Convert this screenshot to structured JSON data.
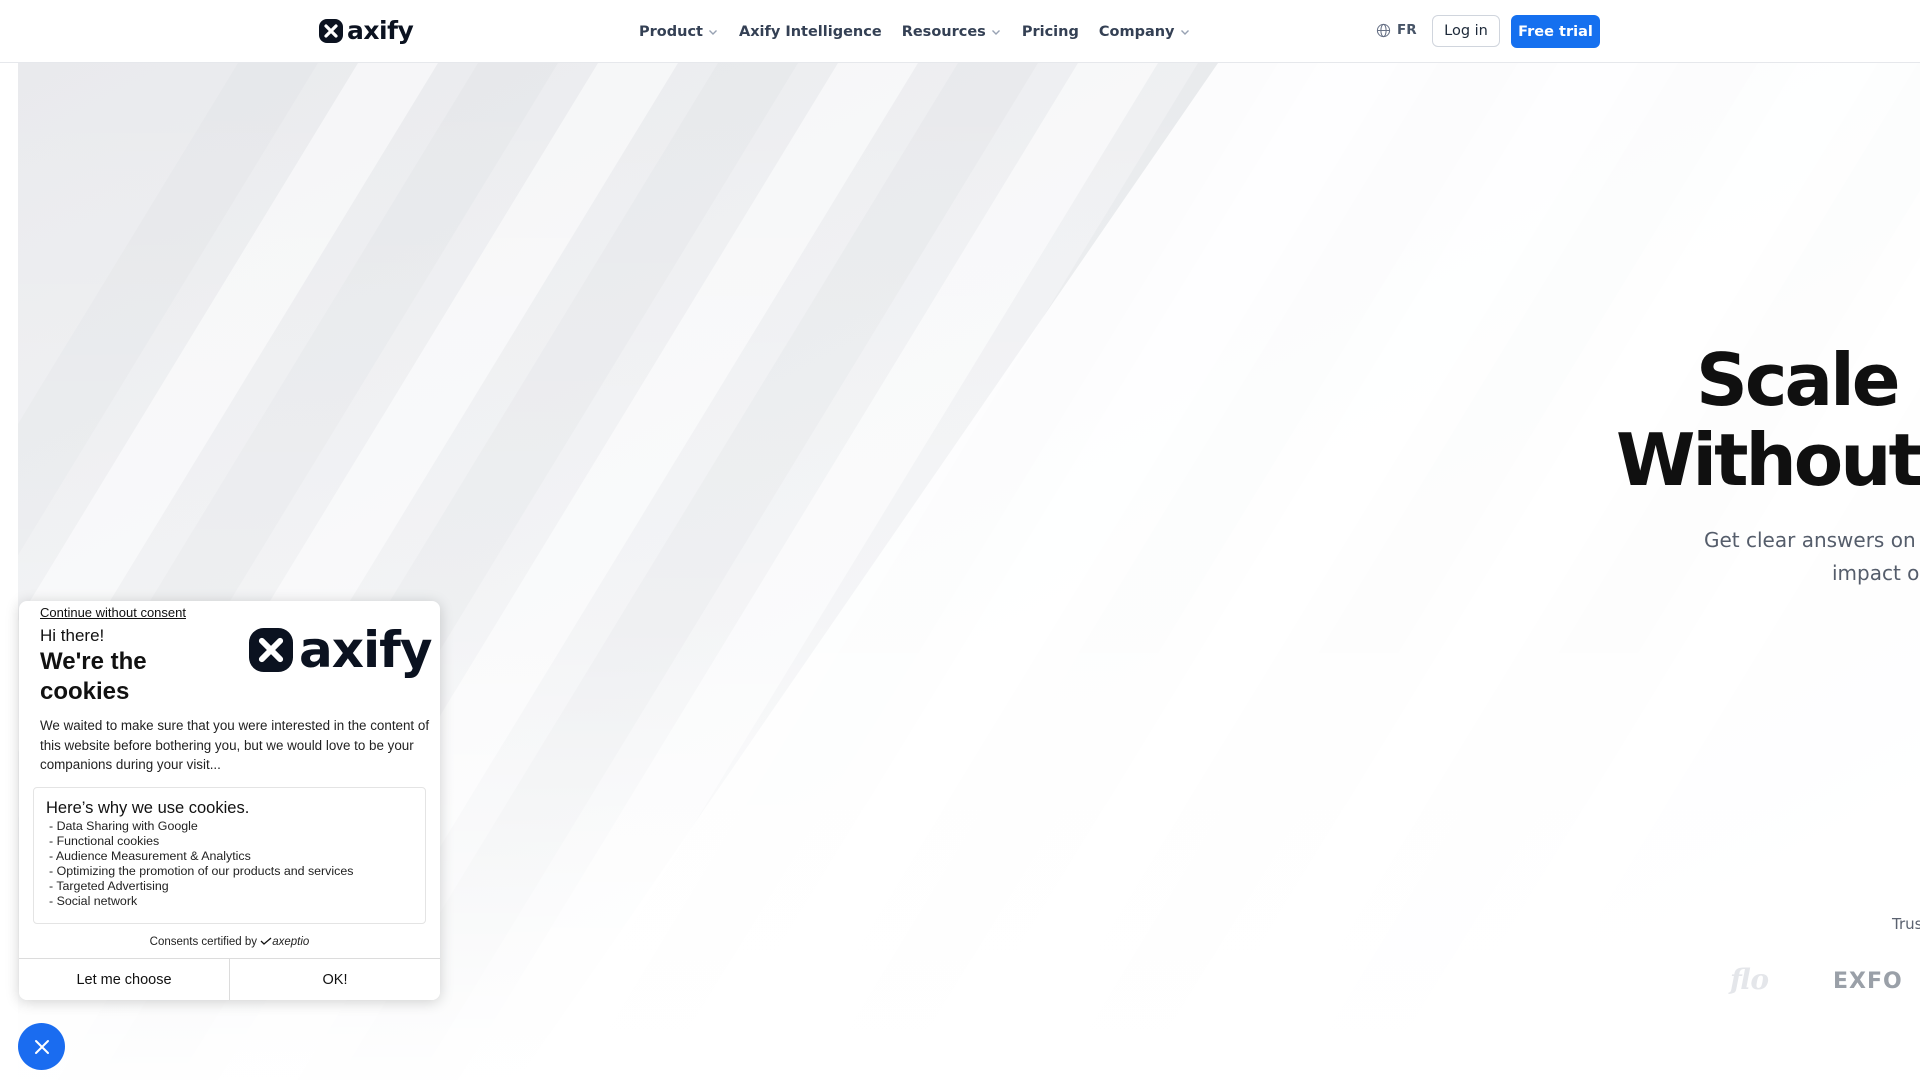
{
  "nav": {
    "logo_text": "axify",
    "menu": [
      {
        "label": "Product",
        "has_dropdown": true
      },
      {
        "label": "Axify Intelligence",
        "has_dropdown": false
      },
      {
        "label": "Resources",
        "has_dropdown": true
      },
      {
        "label": "Pricing",
        "has_dropdown": false
      },
      {
        "label": "Company",
        "has_dropdown": true
      }
    ],
    "language": "FR",
    "login_label": "Log in",
    "trial_label": "Free trial",
    "accent_color": "#1570ef"
  },
  "hero": {
    "title_line1": "Scale A",
    "title_line2": "Without I",
    "subtitle_line1": "Get clear answers on A",
    "subtitle_line2": "impact or",
    "trusted_text": "Trus",
    "customer_logos": [
      "flo",
      "EXFO"
    ]
  },
  "cookie_dialog": {
    "continue_link": "Continue without consent",
    "greeting": "Hi there!",
    "title": "We're the cookies",
    "brand_text": "axify",
    "body": "We waited to make sure that you were interested in the content of this website before bothering you, but we would love to be your companions during your visit...",
    "box_title": "Here’s why we use cookies.",
    "purposes": [
      "- Data Sharing with Google",
      "- Functional cookies",
      "- Audience Measurement & Analytics",
      "- Optimizing the promotion of our products and services",
      "- Targeted Advertising",
      "- Social network"
    ],
    "certified_prefix": "Consents certified by",
    "certified_brand": "axeptio",
    "choose_label": "Let me choose",
    "ok_label": "OK!"
  },
  "icons": {
    "close_fab": "close-icon",
    "language": "globe-icon",
    "dropdown": "chevron-down-icon"
  }
}
